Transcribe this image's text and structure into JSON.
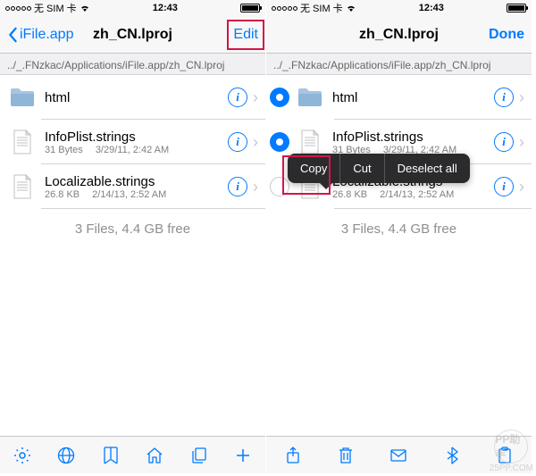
{
  "statusbar": {
    "carrier": "无 SIM 卡",
    "time": "12:43"
  },
  "left": {
    "back": "iFile.app",
    "title": "zh_CN.lproj",
    "edit": "Edit",
    "path": "../_.FNzkac/Applications/iFile.app/zh_CN.lproj",
    "summary": "3 Files, 4.4 GB free"
  },
  "right": {
    "title": "zh_CN.lproj",
    "done": "Done",
    "path": "../_.FNzkac/Applications/iFile.app/zh_CN.lproj",
    "summary": "3 Files, 4.4 GB free"
  },
  "files": [
    {
      "name": "html",
      "type": "folder",
      "size": "",
      "date": ""
    },
    {
      "name": "InfoPlist.strings",
      "type": "file",
      "size": "31 Bytes",
      "date": "3/29/11, 2:42 AM"
    },
    {
      "name": "Localizable.strings",
      "type": "file",
      "size": "26.8 KB",
      "date": "2/14/13, 2:52 AM"
    }
  ],
  "sel": [
    true,
    true,
    false
  ],
  "menu": {
    "copy": "Copy",
    "cut": "Cut",
    "deselect": "Deselect all"
  },
  "wm": {
    "brand": "PP助手",
    "url": "25PP.COM"
  }
}
